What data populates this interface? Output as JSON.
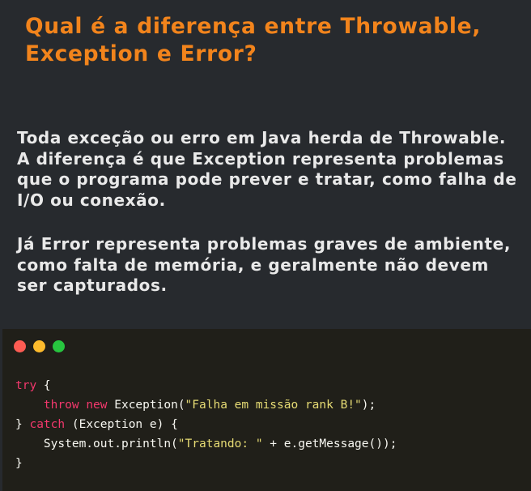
{
  "title": "Qual é a diferença entre Throwable, Exception e Error?",
  "paragraphs": [
    "Toda exceção ou erro em Java herda de Throwable. A diferença é que Exception representa problemas que o programa pode prever e tratar, como falha de I/O ou conexão.",
    "Já Error representa problemas graves de ambiente, como falta de memória, e geralmente não devem ser capturados."
  ],
  "code_window": {
    "window_buttons": [
      "close-dot",
      "minimize-dot",
      "maximize-dot"
    ],
    "colors": {
      "background": "#201f19",
      "keyword": "#f4386d",
      "string": "#e6db74",
      "plain": "#f8f8f2",
      "close": "#fd5c53",
      "minimize": "#fdbb2c",
      "maximize": "#27c53f"
    },
    "lines": [
      {
        "kw1": "try",
        "t1": " {"
      },
      {
        "indent": "    ",
        "kw1": "throw",
        "sp": " ",
        "kw2": "new",
        "t1": " Exception(",
        "str": "\"Falha em missão rank B!\"",
        "t2": ");"
      },
      {
        "t0": "} ",
        "kw1": "catch",
        "t1": " (Exception e) {"
      },
      {
        "indent": "    ",
        "t1": "System.out.println(",
        "str": "\"Tratando: \"",
        "t2": " + e.getMessage());"
      },
      {
        "t1": "}"
      }
    ]
  },
  "colors": {
    "page_background": "#272a2e",
    "title": "#f2841c",
    "body_text": "#e9e9e9"
  }
}
